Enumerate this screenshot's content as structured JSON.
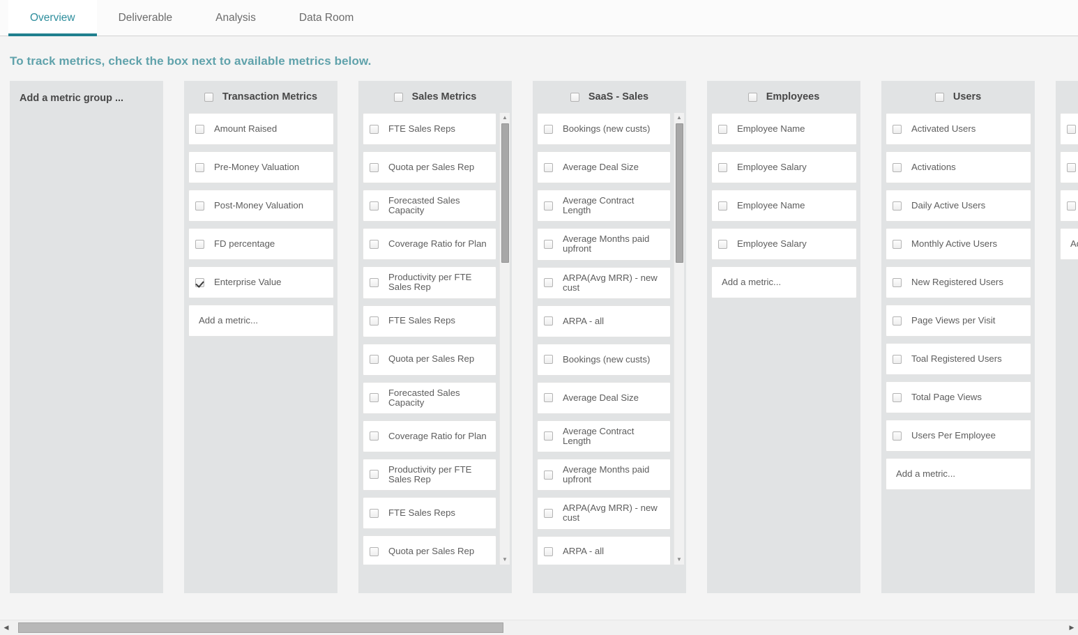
{
  "tabs": [
    {
      "label": "Overview",
      "active": true
    },
    {
      "label": "Deliverable",
      "active": false
    },
    {
      "label": "Analysis",
      "active": false
    },
    {
      "label": "Data Room",
      "active": false
    }
  ],
  "heading": "To track metrics, check the box next to available metrics below.",
  "colors": {
    "accent_teal": "#20808f",
    "heading_teal": "#60a2ab",
    "page_bg": "#f4f4f4",
    "group_bg": "#e1e3e4",
    "row_bg": "#ffffff"
  },
  "add_group": {
    "label": "Add a metric group ..."
  },
  "add_metric_label": "Add a metric...",
  "groups": [
    {
      "title": "Transaction Metrics",
      "checked": false,
      "scrollable": false,
      "metrics": [
        {
          "label": "Amount Raised",
          "checked": false
        },
        {
          "label": "Pre-Money Valuation",
          "checked": false
        },
        {
          "label": "Post-Money Valuation",
          "checked": false
        },
        {
          "label": "FD percentage",
          "checked": false
        },
        {
          "label": "Enterprise Value",
          "checked": true
        }
      ],
      "has_adder": true
    },
    {
      "title": "Sales Metrics",
      "checked": false,
      "scrollable": true,
      "metrics": [
        {
          "label": "FTE Sales Reps",
          "checked": false
        },
        {
          "label": "Quota per Sales Rep",
          "checked": false
        },
        {
          "label": "Forecasted Sales Capacity",
          "checked": false
        },
        {
          "label": "Coverage Ratio for Plan",
          "checked": false
        },
        {
          "label": "Productivity per FTE Sales Rep",
          "checked": false
        },
        {
          "label": "FTE Sales Reps",
          "checked": false
        },
        {
          "label": "Quota per Sales Rep",
          "checked": false
        },
        {
          "label": "Forecasted Sales Capacity",
          "checked": false
        },
        {
          "label": "Coverage Ratio for Plan",
          "checked": false
        },
        {
          "label": "Productivity per FTE Sales Rep",
          "checked": false
        },
        {
          "label": "FTE Sales Reps",
          "checked": false
        },
        {
          "label": "Quota per Sales Rep",
          "checked": false
        }
      ],
      "has_adder": false
    },
    {
      "title": "SaaS - Sales",
      "checked": false,
      "scrollable": true,
      "metrics": [
        {
          "label": "Bookings (new custs)",
          "checked": false
        },
        {
          "label": "Average Deal Size",
          "checked": false
        },
        {
          "label": "Average Contract Length",
          "checked": false
        },
        {
          "label": "Average Months paid upfront",
          "checked": false
        },
        {
          "label": "ARPA(Avg MRR) - new cust",
          "checked": false
        },
        {
          "label": "ARPA - all",
          "checked": false
        },
        {
          "label": "Bookings (new custs)",
          "checked": false
        },
        {
          "label": "Average Deal Size",
          "checked": false
        },
        {
          "label": "Average Contract Length",
          "checked": false
        },
        {
          "label": "Average Months paid upfront",
          "checked": false
        },
        {
          "label": "ARPA(Avg MRR) - new cust",
          "checked": false
        },
        {
          "label": "ARPA - all",
          "checked": false
        }
      ],
      "has_adder": false
    },
    {
      "title": "Employees",
      "checked": false,
      "scrollable": false,
      "metrics": [
        {
          "label": "Employee Name",
          "checked": false
        },
        {
          "label": "Employee Salary",
          "checked": false
        },
        {
          "label": "Employee Name",
          "checked": false
        },
        {
          "label": "Employee Salary",
          "checked": false
        }
      ],
      "has_adder": true
    },
    {
      "title": "Users",
      "checked": false,
      "scrollable": false,
      "metrics": [
        {
          "label": "Activated Users",
          "checked": false
        },
        {
          "label": "Activations",
          "checked": false
        },
        {
          "label": "Daily Active Users",
          "checked": false
        },
        {
          "label": "Monthly Active Users",
          "checked": false
        },
        {
          "label": "New Registered Users",
          "checked": false
        },
        {
          "label": "Page Views per Visit",
          "checked": false
        },
        {
          "label": "Toal Registered Users",
          "checked": false
        },
        {
          "label": "Total Page Views",
          "checked": false
        },
        {
          "label": "Users Per Employee",
          "checked": false
        }
      ],
      "has_adder": true
    },
    {
      "title": "",
      "checked": false,
      "scrollable": false,
      "metrics": [
        {
          "label": "",
          "checked": false
        },
        {
          "label": "",
          "checked": false
        },
        {
          "label": "",
          "checked": false
        }
      ],
      "has_adder": true
    }
  ],
  "scrollbars": {
    "horizontal": {
      "left_arrow": "◀",
      "right_arrow": "▶"
    },
    "vertical": {
      "up_arrow": "▲",
      "down_arrow": "▼"
    }
  }
}
